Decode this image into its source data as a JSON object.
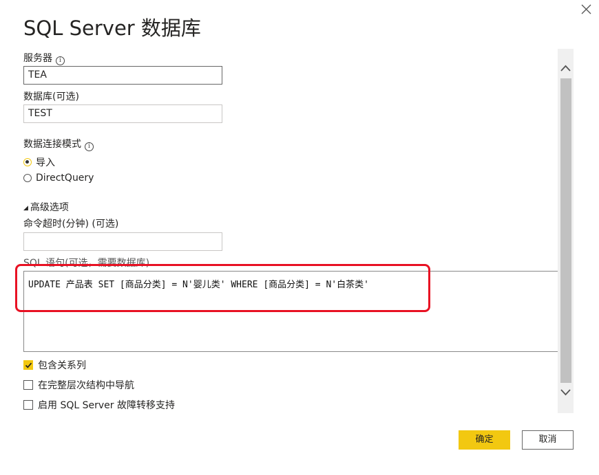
{
  "dialog": {
    "title": "SQL Server 数据库",
    "close_label": "×"
  },
  "server": {
    "label": "服务器",
    "info": "i",
    "value": "TEA"
  },
  "database": {
    "label": "数据库(可选)",
    "value": "TEST"
  },
  "connectivity": {
    "label": "数据连接模式",
    "info": "i",
    "options": [
      {
        "label": "导入",
        "checked": true
      },
      {
        "label": "DirectQuery",
        "checked": false
      }
    ]
  },
  "advanced": {
    "toggle_label": "高级选项",
    "timeout_label": "命令超时(分钟) (可选)",
    "timeout_value": "",
    "sql_label": "SQL 语句(可选，需要数据库)",
    "sql_value": "UPDATE 产品表 SET [商品分类] = N'婴儿类' WHERE [商品分类] = N'白茶类'"
  },
  "checkboxes": [
    {
      "label": "包含关系列",
      "checked": true
    },
    {
      "label": "在完整层次结构中导航",
      "checked": false
    },
    {
      "label": "启用 SQL Server 故障转移支持",
      "checked": false
    }
  ],
  "buttons": {
    "ok": "确定",
    "cancel": "取消"
  },
  "colors": {
    "accent": "#f2c811",
    "highlight": "#e81123"
  }
}
